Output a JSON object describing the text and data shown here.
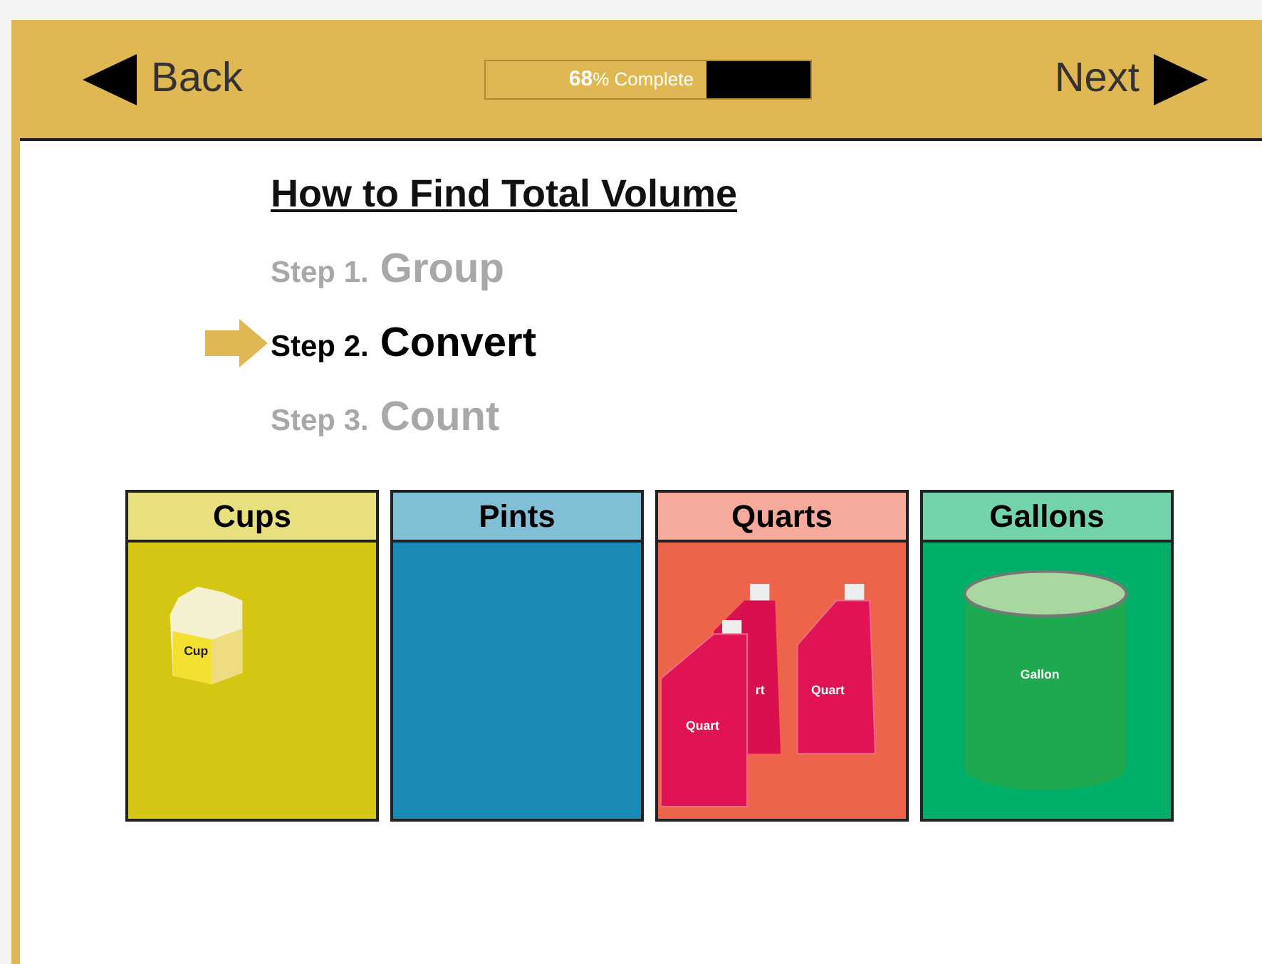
{
  "nav": {
    "back": "Back",
    "next": "Next"
  },
  "progress": {
    "percent": "68",
    "suffix": "% Complete",
    "level": 0.68
  },
  "title": "How to Find Total Volume",
  "steps": [
    {
      "prefix": "Step 1.",
      "name": "Group",
      "current": false
    },
    {
      "prefix": "Step 2.",
      "name": "Convert",
      "current": true
    },
    {
      "prefix": "Step 3.",
      "name": "Count",
      "current": false
    }
  ],
  "columns": [
    {
      "heading": "Cups",
      "color": "#d6c614",
      "kind": "cup",
      "labels": [
        "Cup"
      ]
    },
    {
      "heading": "Pints",
      "color": "#1a8ab6",
      "kind": "empty"
    },
    {
      "heading": "Quarts",
      "color": "#ee644a",
      "kind": "quart",
      "labels": [
        "rt",
        "Quart",
        "Quart"
      ]
    },
    {
      "heading": "Gallons",
      "color": "#00b068",
      "kind": "gallon",
      "labels": [
        "Gallon"
      ]
    }
  ]
}
